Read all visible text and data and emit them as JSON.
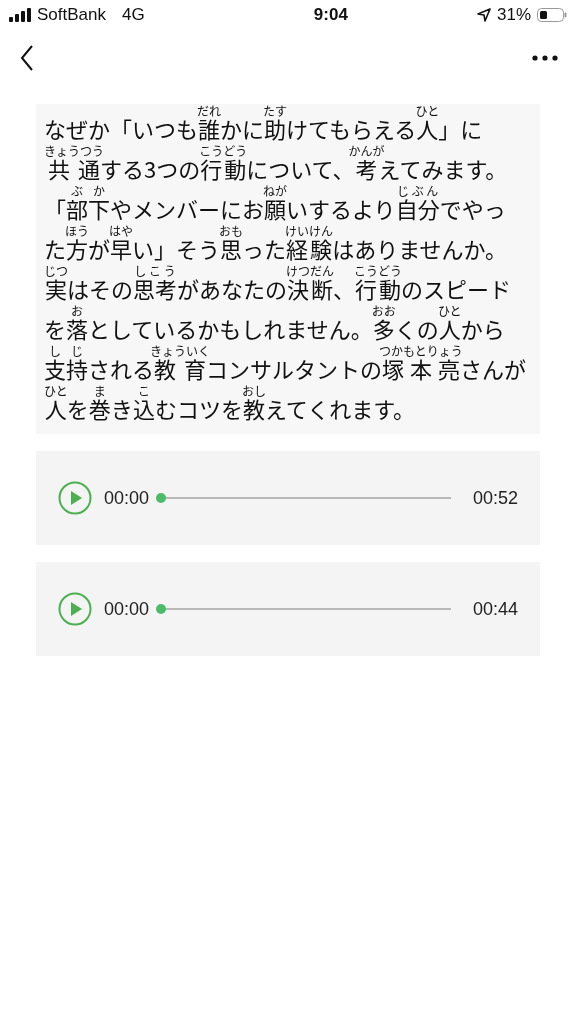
{
  "status_bar": {
    "carrier": "SoftBank",
    "network": "4G",
    "time": "9:04",
    "battery": "31%"
  },
  "article": {
    "lines": [
      [
        {
          "text": "なぜか「いつも"
        },
        {
          "text": "誰",
          "ruby": "だれ"
        },
        {
          "text": "かに"
        },
        {
          "text": "助",
          "ruby": "たす"
        },
        {
          "text": "けてもらえる"
        },
        {
          "text": "人",
          "ruby": "ひと"
        },
        {
          "text": "」に"
        }
      ],
      [
        {
          "text": "共通",
          "ruby": "きょうつう"
        },
        {
          "text": "する3つの"
        },
        {
          "text": "行動",
          "ruby": "こうどう"
        },
        {
          "text": "について、"
        },
        {
          "text": "考",
          "ruby": "かんが"
        },
        {
          "text": "えてみます。"
        }
      ],
      [
        {
          "text": "「"
        },
        {
          "text": "部下",
          "ruby": "ぶか"
        },
        {
          "text": "やメンバーにお"
        },
        {
          "text": "願",
          "ruby": "ねが"
        },
        {
          "text": "いするより"
        },
        {
          "text": "自分",
          "ruby": "じぶん"
        },
        {
          "text": "でやっ"
        }
      ],
      [
        {
          "text": "た"
        },
        {
          "text": "方",
          "ruby": "ほう"
        },
        {
          "text": "が"
        },
        {
          "text": "早",
          "ruby": "はや"
        },
        {
          "text": "い」そう"
        },
        {
          "text": "思",
          "ruby": "おも"
        },
        {
          "text": "った"
        },
        {
          "text": "経験",
          "ruby": "けいけん"
        },
        {
          "text": "はありませんか。"
        }
      ],
      [
        {
          "text": "実",
          "ruby": "じつ"
        },
        {
          "text": "はその"
        },
        {
          "text": "思考",
          "ruby": "しこう"
        },
        {
          "text": "があなたの"
        },
        {
          "text": "決断",
          "ruby": "けつだん"
        },
        {
          "text": "、"
        },
        {
          "text": "行動",
          "ruby": "こうどう"
        },
        {
          "text": "のスピード"
        }
      ],
      [
        {
          "text": "を"
        },
        {
          "text": "落",
          "ruby": "お"
        },
        {
          "text": "としているかもしれません。"
        },
        {
          "text": "多",
          "ruby": "おお"
        },
        {
          "text": "くの"
        },
        {
          "text": "人",
          "ruby": "ひと"
        },
        {
          "text": "から"
        }
      ],
      [
        {
          "text": "支持",
          "ruby": "しじ"
        },
        {
          "text": "される"
        },
        {
          "text": "教育",
          "ruby": "きょういく"
        },
        {
          "text": "コンサルタントの"
        },
        {
          "text": "塚本亮",
          "ruby": "つかもとりょう"
        },
        {
          "text": "さんが"
        }
      ],
      [
        {
          "text": "人",
          "ruby": "ひと"
        },
        {
          "text": "を"
        },
        {
          "text": "巻",
          "ruby": "ま"
        },
        {
          "text": "き"
        },
        {
          "text": "込",
          "ruby": "こ"
        },
        {
          "text": "むコツを"
        },
        {
          "text": "教",
          "ruby": "おし"
        },
        {
          "text": "えてくれます。"
        }
      ]
    ]
  },
  "audio_players": [
    {
      "elapsed": "00:00",
      "duration": "00:52",
      "level": 0
    },
    {
      "elapsed": "00:00",
      "duration": "00:44",
      "level": 0
    }
  ]
}
